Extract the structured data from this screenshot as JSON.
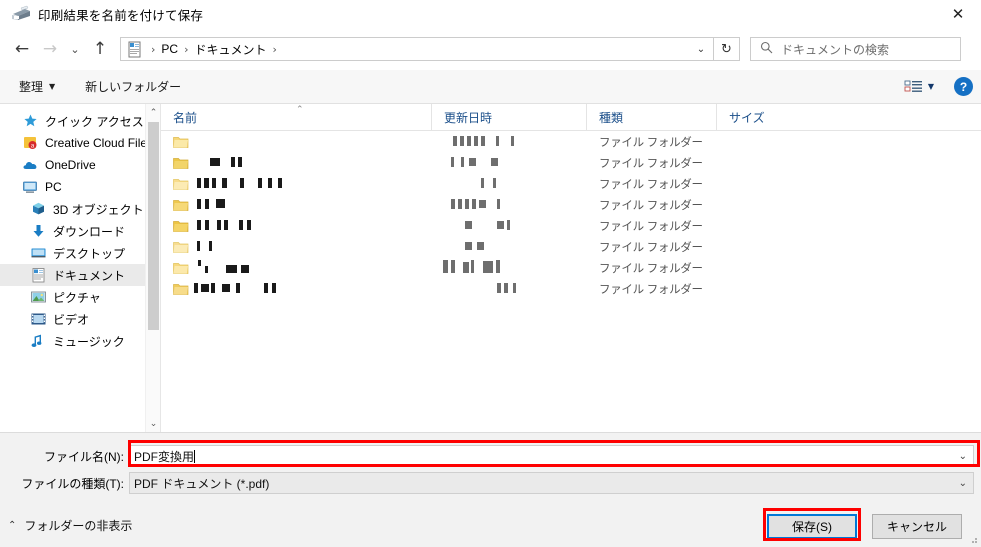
{
  "window": {
    "title": "印刷結果を名前を付けて保存",
    "title_icon": "printer-icon",
    "close_label": "✕"
  },
  "nav": {
    "back_icon": "←",
    "forward_icon": "→",
    "history_icon": "⌄",
    "up_icon": "↑",
    "breadcrumb": {
      "icon": "documents-folder-icon",
      "items": [
        "PC",
        "ドキュメント"
      ],
      "separator": "›",
      "trailing_separator": "›",
      "dropdown_icon": "⌄"
    },
    "refresh_icon": "↻",
    "refresh_label": "更新"
  },
  "search": {
    "icon": "search-icon",
    "placeholder": "ドキュメントの検索",
    "value": ""
  },
  "toolbar": {
    "organize_label": "整理",
    "organize_caret": "▼",
    "new_folder_label": "新しいフォルダー",
    "view_icon": "view-list-icon",
    "view_caret": "▼",
    "help_label": "?"
  },
  "sidebar": {
    "items": [
      {
        "label": "クイック アクセス",
        "icon": "star-icon",
        "indent": false,
        "selected": false
      },
      {
        "label": "Creative Cloud File",
        "icon": "creative-cloud-icon",
        "indent": false,
        "selected": false
      },
      {
        "label": "OneDrive",
        "icon": "cloud-icon",
        "indent": false,
        "selected": false
      },
      {
        "label": "PC",
        "icon": "computer-icon",
        "indent": false,
        "selected": false
      },
      {
        "label": "3D オブジェクト",
        "icon": "cube-icon",
        "indent": true,
        "selected": false
      },
      {
        "label": "ダウンロード",
        "icon": "download-arrow-icon",
        "indent": true,
        "selected": false
      },
      {
        "label": "デスクトップ",
        "icon": "desktop-icon",
        "indent": true,
        "selected": false
      },
      {
        "label": "ドキュメント",
        "icon": "documents-icon",
        "indent": true,
        "selected": true
      },
      {
        "label": "ピクチャ",
        "icon": "pictures-icon",
        "indent": true,
        "selected": false
      },
      {
        "label": "ビデオ",
        "icon": "video-icon",
        "indent": true,
        "selected": false
      },
      {
        "label": "ミュージック",
        "icon": "music-note-icon",
        "indent": true,
        "selected": false
      }
    ],
    "scroll_up_icon": "⌃",
    "scroll_down_icon": "⌄"
  },
  "filelist": {
    "columns": [
      {
        "label": "名前",
        "sorted": true,
        "sort_icon": "⌃"
      },
      {
        "label": "更新日時",
        "sorted": false,
        "sort_icon": ""
      },
      {
        "label": "種類",
        "sorted": false,
        "sort_icon": ""
      },
      {
        "label": "サイズ",
        "sorted": false,
        "sort_icon": ""
      }
    ],
    "rows": [
      {
        "name": "",
        "date": "",
        "type": "ファイル フォルダー",
        "size": "",
        "redacted": true
      },
      {
        "name": "",
        "date": "",
        "type": "ファイル フォルダー",
        "size": "",
        "redacted": true
      },
      {
        "name": "",
        "date": "",
        "type": "ファイル フォルダー",
        "size": "",
        "redacted": true
      },
      {
        "name": "",
        "date": "",
        "type": "ファイル フォルダー",
        "size": "",
        "redacted": true
      },
      {
        "name": "",
        "date": "",
        "type": "ファイル フォルダー",
        "size": "",
        "redacted": true
      },
      {
        "name": "",
        "date": "",
        "type": "ファイル フォルダー",
        "size": "",
        "redacted": true
      },
      {
        "name": "",
        "date": "",
        "type": "ファイル フォルダー",
        "size": "",
        "redacted": true
      },
      {
        "name": "",
        "date": "",
        "type": "ファイル フォルダー",
        "size": "",
        "redacted": true
      }
    ]
  },
  "form": {
    "filename_label": "ファイル名(N):",
    "filename_value": "PDF変換用",
    "filename_chevron": "⌄",
    "filetype_label": "ファイルの種類(T):",
    "filetype_value": "PDF ドキュメント (*.pdf)",
    "filetype_chevron": "⌄"
  },
  "footer": {
    "hide_folders_label": "フォルダーの非表示",
    "hide_folders_chevron": "⌃",
    "save_label": "保存(S)",
    "cancel_label": "キャンセル"
  },
  "highlights": {
    "color": "#fe0000",
    "targets": [
      "filename-field",
      "save-button"
    ]
  }
}
